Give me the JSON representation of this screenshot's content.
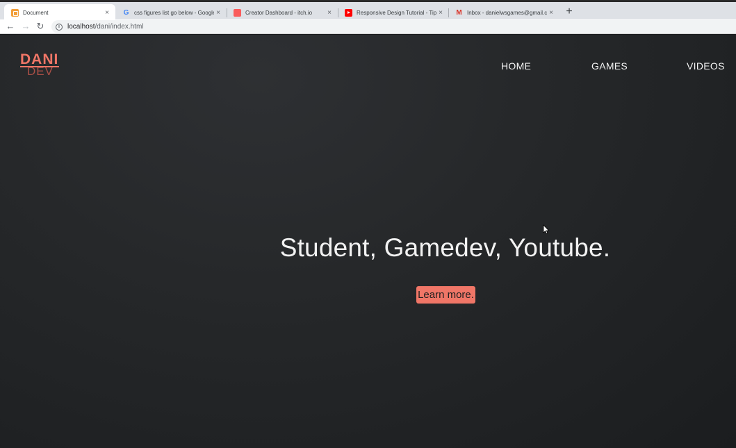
{
  "browser": {
    "tabs": [
      {
        "title": "Document",
        "favicon": "document-favicon-icon",
        "active": true
      },
      {
        "title": "css figures list go below - Google Se",
        "favicon": "google-favicon-icon",
        "active": false
      },
      {
        "title": "Creator Dashboard - itch.io",
        "favicon": "itchio-favicon-icon",
        "active": false
      },
      {
        "title": "Responsive Design Tutorial - Tips fo",
        "favicon": "youtube-favicon-icon",
        "active": false
      },
      {
        "title": "Inbox - danielwsgames@gmail.com",
        "favicon": "gmail-favicon-icon",
        "active": false
      }
    ],
    "new_tab_symbol": "+",
    "close_symbol": "×",
    "back_symbol": "←",
    "forward_symbol": "→",
    "reload_symbol": "↻",
    "info_symbol": "i",
    "url_host": "localhost",
    "url_path": "/dani/index.html"
  },
  "site": {
    "logo": {
      "top": "DANI",
      "bottom": "DEV"
    },
    "nav": [
      "HOME",
      "GAMES",
      "VIDEOS"
    ],
    "hero_title": "Student, Gamedev, Youtube.",
    "cta_label": "Learn more."
  },
  "colors": {
    "accent": "#f07667",
    "logo_secondary": "#a94f46",
    "background": "#25272a",
    "text": "#f2f2f2"
  }
}
